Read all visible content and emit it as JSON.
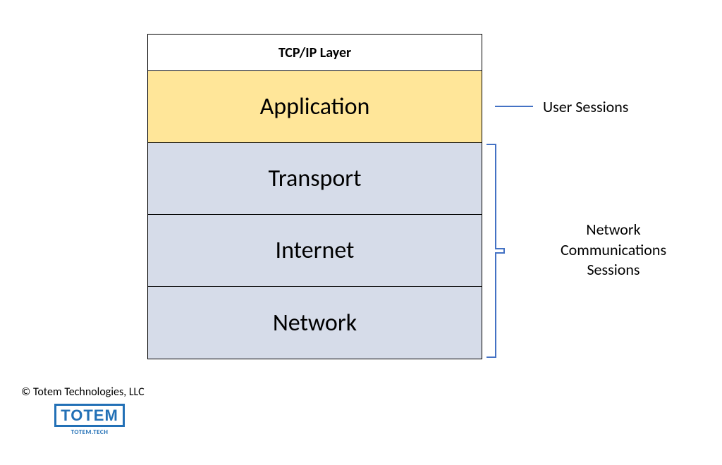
{
  "header": "TCP/IP Layer",
  "layers": [
    {
      "name": "Application",
      "fill": "yellow"
    },
    {
      "name": "Transport",
      "fill": "blue"
    },
    {
      "name": "Internet",
      "fill": "blue"
    },
    {
      "name": "Network",
      "fill": "blue"
    }
  ],
  "annotations": {
    "user_sessions": "User Sessions",
    "network_sessions_line1": "Network",
    "network_sessions_line2": "Communications",
    "network_sessions_line3": "Sessions"
  },
  "footer": {
    "copyright": "© Totem Technologies, LLC",
    "logo_main": "TOTEM",
    "logo_sub": "TOTEM.TECH"
  }
}
